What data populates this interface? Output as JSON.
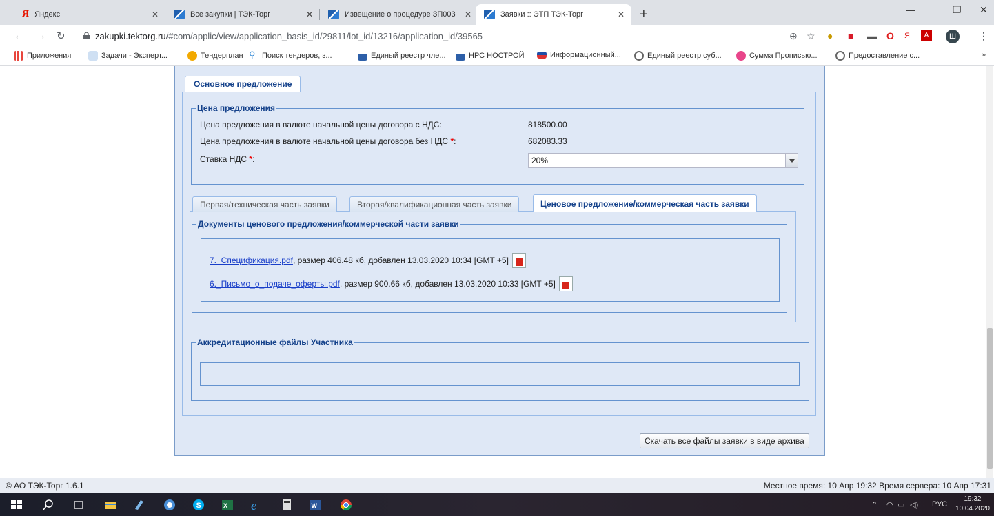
{
  "browser": {
    "tabs": [
      {
        "title": "Яндекс",
        "favicon": "yandex-icon"
      },
      {
        "title": "Все закупки | ТЭК-Торг",
        "favicon": "tektorg-icon"
      },
      {
        "title": "Извещение о процедуре ЗП003",
        "favicon": "tektorg-icon"
      },
      {
        "title": "Заявки :: ЭТП ТЭК-Торг",
        "favicon": "tektorg-icon"
      }
    ],
    "new_tab": "+",
    "url_host": "zakupki.tektorg.ru",
    "url_path": "/#com/applic/view/application_basis_id/29811/lot_id/13216/application_id/39565",
    "profile_letter": "Ш",
    "bookmarks": [
      {
        "label": "Приложения",
        "color": "#e8453c"
      },
      {
        "label": "Задачи - Эксперт...",
        "color": "#7fa7d9"
      },
      {
        "label": "Тендерплан",
        "color": "#f2a900"
      },
      {
        "label": "Поиск тендеров, з...",
        "color": "#3d8fd8"
      },
      {
        "label": "Единый реестр чле...",
        "color": "#2d5fa8"
      },
      {
        "label": "НРС НОСТРОЙ",
        "color": "#2d5fa8"
      },
      {
        "label": "Информационный...",
        "color": "#d33"
      },
      {
        "label": "Единый реестр суб...",
        "color": "#666"
      },
      {
        "label": "Сумма Прописью...",
        "color": "#e8458a"
      },
      {
        "label": "Предоставление с...",
        "color": "#666"
      }
    ],
    "more": "»"
  },
  "main": {
    "tab_label": "Основное предложение",
    "price": {
      "legend": "Цена предложения",
      "with_vat_label": "Цена предложения в валюте начальной цены договора с НДС:",
      "with_vat_value": "818500.00",
      "without_vat_label": "Цена предложения в валюте начальной цены договора без НДС ",
      "without_vat_value": "682083.33",
      "vat_rate_label": "Ставка НДС ",
      "vat_rate_value": "20%",
      "required_mark": "*",
      "colon": ":"
    },
    "sub_tabs": [
      {
        "label": "Первая/техническая часть заявки",
        "active": false
      },
      {
        "label": "Вторая/квалификационная часть заявки",
        "active": false
      },
      {
        "label": "Ценовое предложение/коммерческая часть заявки",
        "active": true
      }
    ],
    "documents": {
      "legend": "Документы ценового предложения/коммерческой части заявки",
      "items": [
        {
          "link": "7._Спецификация.pdf",
          "info": ", размер 406.48 кб, добавлен 13.03.2020 10:34 [GMT +5]"
        },
        {
          "link": "6._Письмо_о_подаче_оферты.pdf",
          "info": ", размер 900.66 кб, добавлен 13.03.2020 10:33 [GMT +5]"
        }
      ]
    },
    "accreditation": {
      "legend": "Аккредитационные файлы Участника"
    },
    "download_all_label": "Скачать все файлы заявки в виде архива"
  },
  "footer": {
    "copyright": "© АО ТЭК-Торг 1.6.1",
    "time": "Местное время: 10 Апр 19:32 Время сервера: 10 Апр 17:31"
  },
  "taskbar": {
    "lang": "РУС",
    "time": "19:32",
    "date": "10.04.2020"
  }
}
